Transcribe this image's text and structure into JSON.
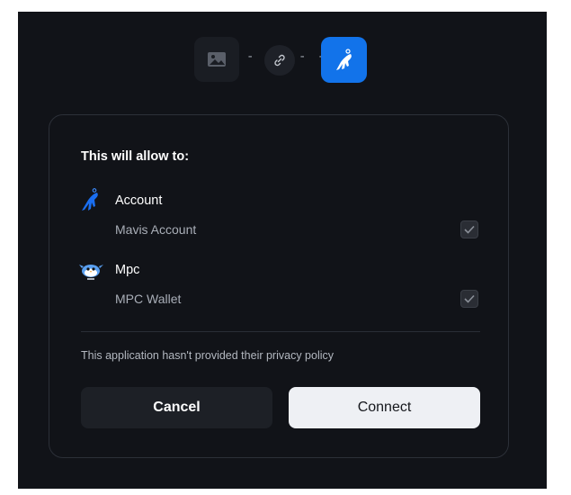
{
  "header": {
    "app_icon": "image-placeholder-icon",
    "link_icon": "link-icon",
    "wallet_icon": "ronin-bird-icon",
    "dash_left": "- -",
    "dash_right": "- -"
  },
  "card": {
    "title": "This will allow to:",
    "permissions": [
      {
        "title": "Account",
        "description": "Mavis Account",
        "icon": "account-bird-icon",
        "checked": true
      },
      {
        "title": "Mpc",
        "description": "MPC Wallet",
        "icon": "mpc-bird-icon",
        "checked": true
      }
    ],
    "privacy_note": "This application hasn't provided their privacy policy",
    "cancel_label": "Cancel",
    "connect_label": "Connect"
  },
  "colors": {
    "background": "#111318",
    "accent": "#1273ea",
    "connect_button": "#eef0f4",
    "cancel_button": "#1d2026"
  }
}
